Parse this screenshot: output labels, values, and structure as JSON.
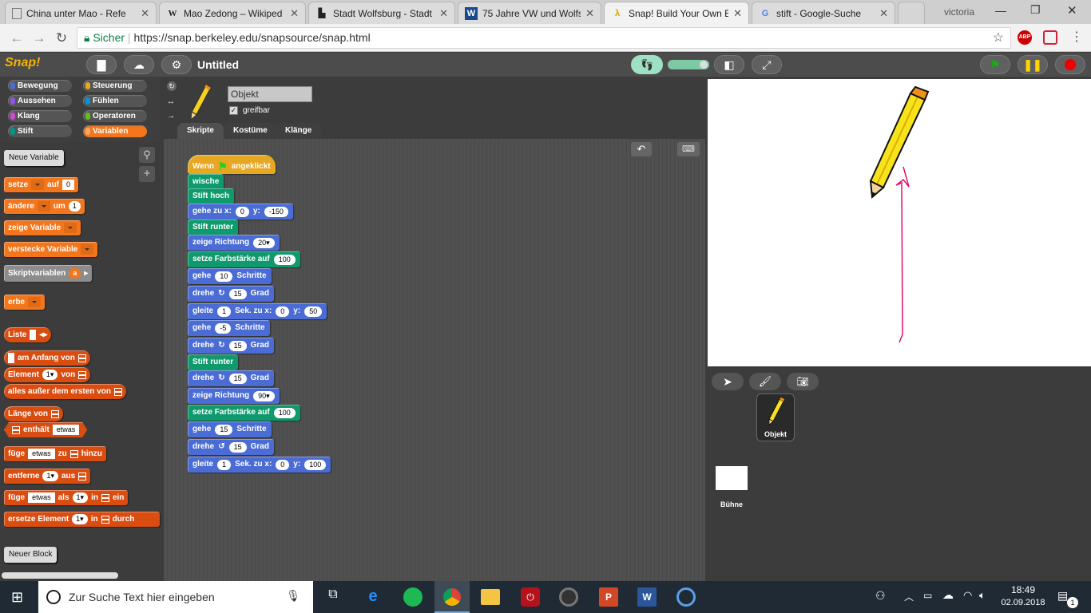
{
  "browser": {
    "tabs": [
      {
        "title": "China unter Mao - Refe",
        "icon": "document-icon"
      },
      {
        "title": "Mao Zedong – Wikiped",
        "icon": "wikipedia-icon"
      },
      {
        "title": "Stadt Wolfsburg - Stadt",
        "icon": "city-icon"
      },
      {
        "title": "75 Jahre VW und Wolfs",
        "icon": "w-icon"
      },
      {
        "title": "Snap! Build Your Own B",
        "icon": "lambda-icon"
      },
      {
        "title": "stift - Google-Suche",
        "icon": "google-icon"
      }
    ],
    "profile": "victoria",
    "secure_label": "Sicher",
    "url": "https://snap.berkeley.edu/snapsource/snap.html"
  },
  "snap": {
    "logo": "Snap!",
    "project_title": "Untitled",
    "categories": [
      {
        "label": "Bewegung",
        "color": "#4a6cd4"
      },
      {
        "label": "Steuerung",
        "color": "#e6a822"
      },
      {
        "label": "Aussehen",
        "color": "#8f56e3"
      },
      {
        "label": "Fühlen",
        "color": "#0494dc"
      },
      {
        "label": "Klang",
        "color": "#cf4ad9"
      },
      {
        "label": "Operatoren",
        "color": "#62c213"
      },
      {
        "label": "Stift",
        "color": "#009982"
      },
      {
        "label": "Variablen",
        "color": "#f3761d"
      }
    ],
    "palette": {
      "new_variable": "Neue Variable",
      "set": "setze",
      "set_to": "auf",
      "set_value": "0",
      "change": "ändere",
      "change_by": "um",
      "change_value": "1",
      "show_var": "zeige Variable",
      "hide_var": "verstecke Variable",
      "script_vars": "Skriptvariablen",
      "script_var_name": "a",
      "inherit": "erbe",
      "list": "Liste",
      "at_start_of": "am Anfang von",
      "element": "Element",
      "element_idx": "1",
      "of": "von",
      "all_but_first": "alles außer dem ersten von",
      "length_of": "Länge von",
      "contains": "enthält",
      "thing": "etwas",
      "add": "füge",
      "to": "zu",
      "add_end": "hinzu",
      "remove": "entferne",
      "remove_idx": "1",
      "remove_from": "aus",
      "insert": "füge",
      "insert_as": "als",
      "insert_idx": "1",
      "insert_in": "in",
      "insert_end": "ein",
      "replace": "ersetze Element",
      "replace_idx": "1",
      "replace_in": "in",
      "replace_end": "durch",
      "new_block": "Neuer Block"
    },
    "sprite": {
      "name": "Objekt",
      "draggable": "greifbar",
      "tabs": [
        "Skripte",
        "Kostüme",
        "Klänge"
      ]
    },
    "script": {
      "hat": "Wenn",
      "hat_end": "angeklickt",
      "b1": "wische",
      "b2": "Stift hoch",
      "b3": "gehe zu x:",
      "b3_x": "0",
      "b3_ylabel": "y:",
      "b3_y": "-150",
      "b4": "Stift runter",
      "b5": "zeige Richtung",
      "b5_v": "20",
      "b6": "setze Farbstärke auf",
      "b6_v": "100",
      "b7": "gehe",
      "b7_v": "10",
      "b7_end": "Schritte",
      "b8": "drehe",
      "b8_v": "15",
      "b8_end": "Grad",
      "b9": "gleite",
      "b9_v": "1",
      "b9_mid": "Sek. zu x:",
      "b9_x": "0",
      "b9_ylabel": "y:",
      "b9_y": "50",
      "b10": "gehe",
      "b10_v": "-5",
      "b10_end": "Schritte",
      "b11": "drehe",
      "b11_v": "15",
      "b11_end": "Grad",
      "b12": "Stift runter",
      "b13": "drehe",
      "b13_v": "15",
      "b13_end": "Grad",
      "b14": "zeige Richtung",
      "b14_v": "90",
      "b15": "setze Farbstärke auf",
      "b15_v": "100",
      "b16": "gehe",
      "b16_v": "15",
      "b16_end": "Schritte",
      "b17": "drehe",
      "b17_v": "15",
      "b17_end": "Grad",
      "b18": "gleite",
      "b18_v": "1",
      "b18_mid": "Sek. zu x:",
      "b18_x": "0",
      "b18_ylabel": "y:",
      "b18_y": "100"
    },
    "corral": {
      "sprite_label": "Objekt",
      "stage_label": "Bühne"
    }
  },
  "taskbar": {
    "search_placeholder": "Zur Suche Text hier eingeben",
    "time": "18:49",
    "date": "02.09.2018",
    "notifications": "1"
  }
}
